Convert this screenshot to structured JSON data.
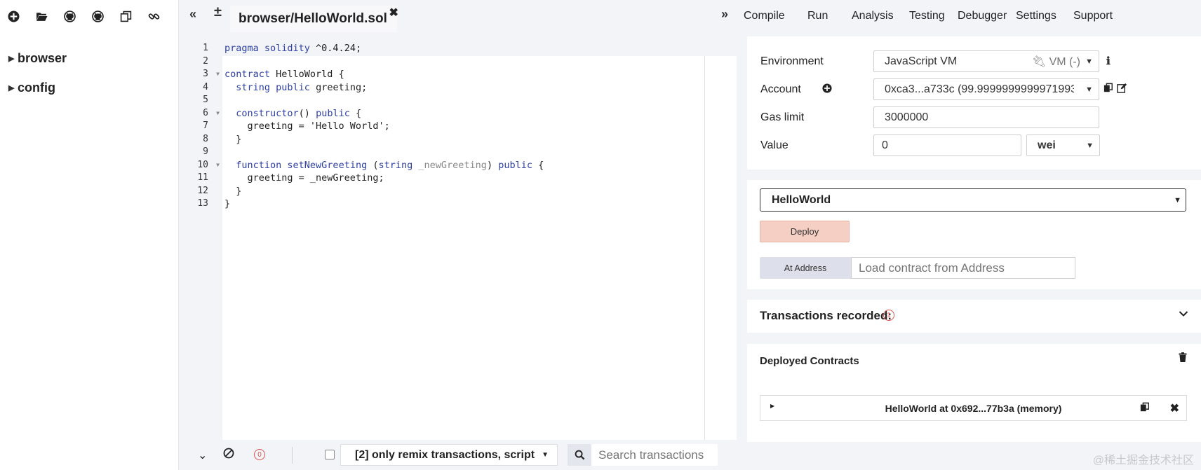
{
  "left_toolbar": {
    "icons": [
      "plus-circle-icon",
      "folder-open-icon",
      "github-icon",
      "github-icon",
      "copy-icon",
      "link-icon"
    ]
  },
  "file_explorer": {
    "items": [
      {
        "label": "browser"
      },
      {
        "label": "config"
      }
    ]
  },
  "editor": {
    "tab_label": "browser/HelloWorld.sol",
    "line_numbers": [
      "1",
      "2",
      "3",
      "4",
      "5",
      "6",
      "7",
      "8",
      "9",
      "10",
      "11",
      "12",
      "13"
    ]
  },
  "terminal": {
    "pending_count": "0",
    "filter_label": "[2] only remix transactions, script",
    "search_placeholder": "Search transactions"
  },
  "top_menu": {
    "items": [
      "Compile",
      "Run",
      "Analysis",
      "Testing",
      "Debugger",
      "Settings",
      "Support"
    ],
    "active": "Run"
  },
  "run": {
    "environment_label": "Environment",
    "environment_value": "JavaScript VM",
    "environment_vm": "VM (-)",
    "account_label": "Account",
    "account_value": "0xca3...a733c (99.9999999999971993",
    "gas_limit_label": "Gas limit",
    "gas_limit_value": "3000000",
    "value_label": "Value",
    "value_amount": "0",
    "value_unit": "wei",
    "contract_selected": "HelloWorld",
    "deploy_label": "Deploy",
    "at_address_label": "At Address",
    "at_address_placeholder": "Load contract from Address",
    "transactions_recorded_label": "Transactions recorded:",
    "transactions_recorded_count": "1",
    "deployed_contracts_label": "Deployed Contracts",
    "deployed_instance": "HelloWorld at 0x692...77b3a (memory)"
  },
  "watermark": "@稀土掘金技术社区"
}
